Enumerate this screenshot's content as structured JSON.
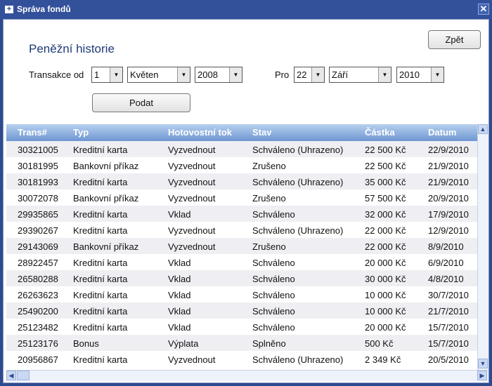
{
  "window": {
    "title": "Správa fondů",
    "close": "✕",
    "icon": "+"
  },
  "page": {
    "title": "Peněžní historie",
    "back_label": "Zpět",
    "submit_label": "Podat"
  },
  "filter": {
    "from_label": "Transakce od",
    "from_day": "1",
    "from_month": "Květen",
    "from_year": "2008",
    "to_label": "Pro",
    "to_day": "22",
    "to_month": "Září",
    "to_year": "2010"
  },
  "table": {
    "headers": [
      "Trans#",
      "Typ",
      "Hotovostní tok",
      "Stav",
      "Částka",
      "Datum"
    ],
    "rows": [
      [
        "30321005",
        "Kreditní karta",
        "Vyzvednout",
        "Schváleno (Uhrazeno)",
        "22 500 Kč",
        "22/9/2010"
      ],
      [
        "30181995",
        "Bankovní příkaz",
        "Vyzvednout",
        "Zrušeno",
        "22 500 Kč",
        "21/9/2010"
      ],
      [
        "30181993",
        "Kreditní karta",
        "Vyzvednout",
        "Schváleno (Uhrazeno)",
        "35 000 Kč",
        "21/9/2010"
      ],
      [
        "30072078",
        "Bankovní příkaz",
        "Vyzvednout",
        "Zrušeno",
        "57 500 Kč",
        "20/9/2010"
      ],
      [
        "29935865",
        "Kreditní karta",
        "Vklad",
        "Schváleno",
        "32 000 Kč",
        "17/9/2010"
      ],
      [
        "29390267",
        "Kreditní karta",
        "Vyzvednout",
        "Schváleno (Uhrazeno)",
        "22 000 Kč",
        "12/9/2010"
      ],
      [
        "29143069",
        "Bankovní příkaz",
        "Vyzvednout",
        "Zrušeno",
        "22 000 Kč",
        "8/9/2010"
      ],
      [
        "28922457",
        "Kreditní karta",
        "Vklad",
        "Schváleno",
        "20 000 Kč",
        "6/9/2010"
      ],
      [
        "26580288",
        "Kreditní karta",
        "Vklad",
        "Schváleno",
        "30 000 Kč",
        "4/8/2010"
      ],
      [
        "26263623",
        "Kreditní karta",
        "Vklad",
        "Schváleno",
        "10 000 Kč",
        "30/7/2010"
      ],
      [
        "25490200",
        "Kreditní karta",
        "Vklad",
        "Schváleno",
        "10 000 Kč",
        "21/7/2010"
      ],
      [
        "25123482",
        "Kreditní karta",
        "Vklad",
        "Schváleno",
        "20 000 Kč",
        "15/7/2010"
      ],
      [
        "25123176",
        "Bonus",
        "Výplata",
        "Splněno",
        "500 Kč",
        "15/7/2010"
      ],
      [
        "20956867",
        "Kreditní karta",
        "Vyzvednout",
        "Schváleno (Uhrazeno)",
        "2 349 Kč",
        "20/5/2010"
      ]
    ]
  }
}
